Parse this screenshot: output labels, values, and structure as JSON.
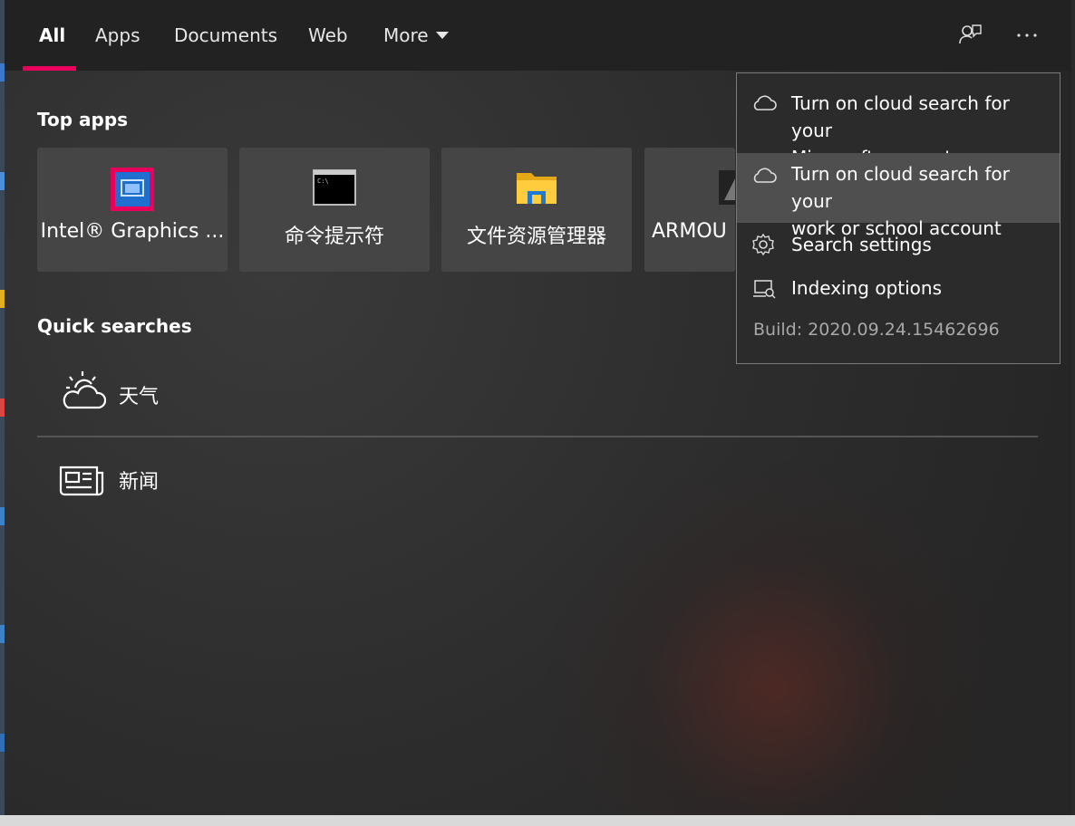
{
  "tabs": [
    {
      "label": "All",
      "active": true
    },
    {
      "label": "Apps"
    },
    {
      "label": "Documents"
    },
    {
      "label": "Web"
    },
    {
      "label": "More"
    }
  ],
  "accent_color": "#e8005b",
  "top_icons": [
    "feedback-icon",
    "more-options-icon"
  ],
  "top_apps": {
    "title": "Top apps",
    "items": [
      {
        "label": "Intel® Graphics ...",
        "icon": "intel-graphics-icon"
      },
      {
        "label": "命令提示符",
        "icon": "command-prompt-icon"
      },
      {
        "label": "文件资源管理器",
        "icon": "file-explorer-icon"
      },
      {
        "label": "ARMOU",
        "icon": "armoury-icon"
      }
    ]
  },
  "quick_searches": {
    "title": "Quick searches",
    "items": [
      {
        "label": "天气",
        "icon": "weather-icon"
      },
      {
        "label": "新闻",
        "icon": "news-icon"
      }
    ]
  },
  "menu": {
    "items": [
      {
        "label_line1": "Turn on cloud search for your",
        "label_line2": "Microsoft account",
        "icon": "cloud-icon"
      },
      {
        "label_line1": "Turn on cloud search for your",
        "label_line2": "work or school account",
        "icon": "cloud-icon",
        "highlighted": true
      },
      {
        "label_line1": "Search settings",
        "icon": "gear-icon"
      },
      {
        "label_line1": "Indexing options",
        "icon": "indexing-icon"
      }
    ],
    "build": "Build: 2020.09.24.15462696"
  }
}
